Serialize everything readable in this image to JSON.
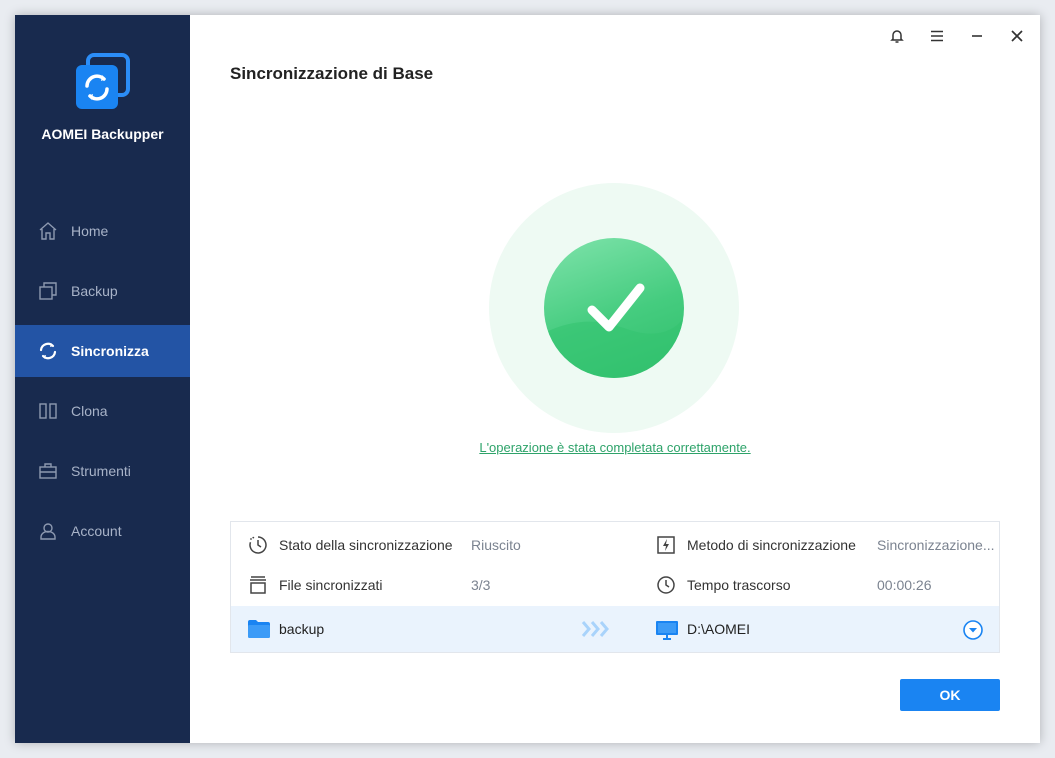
{
  "app": {
    "name": "AOMEI Backupper"
  },
  "sidebar": {
    "items": [
      {
        "label": "Home",
        "icon": "home-icon",
        "active": false
      },
      {
        "label": "Backup",
        "icon": "backup-icon",
        "active": false
      },
      {
        "label": "Sincronizza",
        "icon": "sync-icon",
        "active": true
      },
      {
        "label": "Clona",
        "icon": "clone-icon",
        "active": false
      },
      {
        "label": "Strumenti",
        "icon": "tools-icon",
        "active": false
      },
      {
        "label": "Account",
        "icon": "account-icon",
        "active": false
      }
    ]
  },
  "header": {
    "title": "Sincronizzazione di Base"
  },
  "result": {
    "message": "L'operazione è stata completata correttamente."
  },
  "details": {
    "status_label": "Stato della sincronizzazione",
    "status_value": "Riuscito",
    "method_label": "Metodo di sincronizzazione",
    "method_value": "Sincronizzazione...",
    "files_label": "File sincronizzati",
    "files_value": "3/3",
    "time_label": "Tempo trascorso",
    "time_value": "00:00:26",
    "source": "backup",
    "destination": "D:\\AOMEI"
  },
  "buttons": {
    "ok": "OK"
  },
  "colors": {
    "sidebar_bg": "#182a4e",
    "active_item": "#2354a5",
    "accent": "#1a84f2",
    "success": "#45cc7f"
  }
}
